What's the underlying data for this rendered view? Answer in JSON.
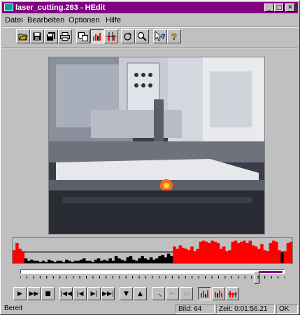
{
  "window": {
    "title": "laser_cutting.263 - HEdit"
  },
  "menu": {
    "items": [
      "Datei",
      "Bearbeiten",
      "Optionen",
      "Hilfe"
    ]
  },
  "toolbar": {
    "buttons": [
      "open-icon",
      "save-icon",
      "save-all-icon",
      "print-icon",
      "copy-icon",
      "histogram-icon",
      "grid-icon",
      "rotate-icon",
      "zoom-icon",
      "context-help-icon",
      "help-icon"
    ]
  },
  "video": {
    "description_label": ""
  },
  "histogram": {
    "levels": [
      0.55,
      0.85,
      0.6,
      0.5,
      0.2,
      0.1,
      0.15,
      0.1,
      0.1,
      0.05,
      0.1,
      0.05,
      0.15,
      0.1,
      0.05,
      0.1,
      0.1,
      0.05,
      0.15,
      0.1,
      0.05,
      0.1,
      0.1,
      0.15,
      0.2,
      0.1,
      0.1,
      0.05,
      0.15,
      0.2,
      0.1,
      0.15,
      0.1,
      0.2,
      0.1,
      0.3,
      0.2,
      0.15,
      0.1,
      0.25,
      0.3,
      0.15,
      0.1,
      0.2,
      0.3,
      0.2,
      0.15,
      0.25,
      0.15,
      0.2,
      0.3,
      0.35,
      0.25,
      0.4,
      0.3,
      0.7,
      0.6,
      0.75,
      0.65,
      0.6,
      0.55,
      0.7,
      0.5,
      0.6,
      0.9,
      0.95,
      0.9,
      0.85,
      0.95,
      0.9,
      0.85,
      0.6,
      0.7,
      0.5,
      0.55,
      0.9,
      0.95,
      0.85,
      0.9,
      0.95,
      0.85,
      0.95,
      0.75,
      0.7,
      0.6,
      0.8,
      0.55,
      0.5,
      0.85,
      0.95,
      0.9,
      0.55,
      0.45,
      0.5,
      0.85,
      0.9
    ],
    "colors": {
      "red": "#ff0000",
      "black": "#000000"
    }
  },
  "slider": {
    "position": 0.91
  },
  "controls": {
    "buttons": [
      "play-icon",
      "fast-forward-icon",
      "stop-icon",
      "skip-to-start-icon",
      "step-back-icon",
      "step-forward-icon",
      "skip-to-end-icon",
      "mark-in-icon",
      "mark-out-icon",
      "search-frame-icon",
      "zoom-out-icon",
      "fees-icon",
      "histogram-view-1-icon",
      "histogram-view-2-icon",
      "histogram-view-3-icon"
    ]
  },
  "status": {
    "ready": "Bereit",
    "frame": "Bild: 64",
    "time": "Zeit: 0:01:56.21",
    "ok": "OK"
  }
}
